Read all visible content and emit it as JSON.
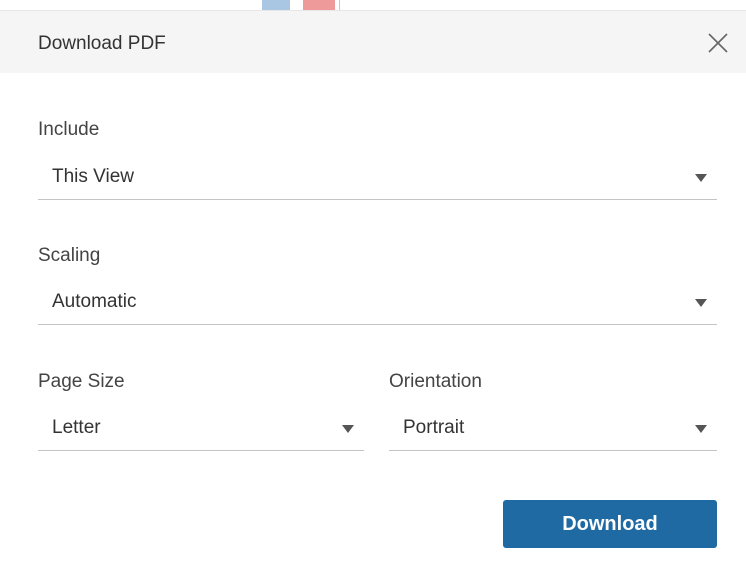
{
  "dialog": {
    "title": "Download PDF",
    "close_icon": "close-icon"
  },
  "include": {
    "label": "Include",
    "value": "This View"
  },
  "scaling": {
    "label": "Scaling",
    "value": "Automatic"
  },
  "page_size": {
    "label": "Page Size",
    "value": "Letter"
  },
  "orientation": {
    "label": "Orientation",
    "value": "Portrait"
  },
  "actions": {
    "download_label": "Download"
  },
  "colors": {
    "header_bg": "#f5f5f5",
    "button_bg": "#1f6aa3",
    "button_text": "#ffffff",
    "underline": "#c4c4c4"
  }
}
